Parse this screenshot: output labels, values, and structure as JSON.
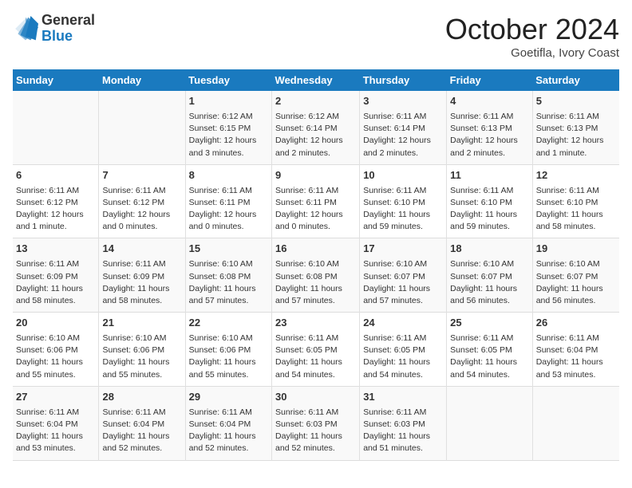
{
  "header": {
    "logo_general": "General",
    "logo_blue": "Blue",
    "month_title": "October 2024",
    "location": "Goetifla, Ivory Coast"
  },
  "days_of_week": [
    "Sunday",
    "Monday",
    "Tuesday",
    "Wednesday",
    "Thursday",
    "Friday",
    "Saturday"
  ],
  "weeks": [
    [
      {
        "day": "",
        "info": ""
      },
      {
        "day": "",
        "info": ""
      },
      {
        "day": "1",
        "info": "Sunrise: 6:12 AM\nSunset: 6:15 PM\nDaylight: 12 hours and 3 minutes."
      },
      {
        "day": "2",
        "info": "Sunrise: 6:12 AM\nSunset: 6:14 PM\nDaylight: 12 hours and 2 minutes."
      },
      {
        "day": "3",
        "info": "Sunrise: 6:11 AM\nSunset: 6:14 PM\nDaylight: 12 hours and 2 minutes."
      },
      {
        "day": "4",
        "info": "Sunrise: 6:11 AM\nSunset: 6:13 PM\nDaylight: 12 hours and 2 minutes."
      },
      {
        "day": "5",
        "info": "Sunrise: 6:11 AM\nSunset: 6:13 PM\nDaylight: 12 hours and 1 minute."
      }
    ],
    [
      {
        "day": "6",
        "info": "Sunrise: 6:11 AM\nSunset: 6:12 PM\nDaylight: 12 hours and 1 minute."
      },
      {
        "day": "7",
        "info": "Sunrise: 6:11 AM\nSunset: 6:12 PM\nDaylight: 12 hours and 0 minutes."
      },
      {
        "day": "8",
        "info": "Sunrise: 6:11 AM\nSunset: 6:11 PM\nDaylight: 12 hours and 0 minutes."
      },
      {
        "day": "9",
        "info": "Sunrise: 6:11 AM\nSunset: 6:11 PM\nDaylight: 12 hours and 0 minutes."
      },
      {
        "day": "10",
        "info": "Sunrise: 6:11 AM\nSunset: 6:10 PM\nDaylight: 11 hours and 59 minutes."
      },
      {
        "day": "11",
        "info": "Sunrise: 6:11 AM\nSunset: 6:10 PM\nDaylight: 11 hours and 59 minutes."
      },
      {
        "day": "12",
        "info": "Sunrise: 6:11 AM\nSunset: 6:10 PM\nDaylight: 11 hours and 58 minutes."
      }
    ],
    [
      {
        "day": "13",
        "info": "Sunrise: 6:11 AM\nSunset: 6:09 PM\nDaylight: 11 hours and 58 minutes."
      },
      {
        "day": "14",
        "info": "Sunrise: 6:11 AM\nSunset: 6:09 PM\nDaylight: 11 hours and 58 minutes."
      },
      {
        "day": "15",
        "info": "Sunrise: 6:10 AM\nSunset: 6:08 PM\nDaylight: 11 hours and 57 minutes."
      },
      {
        "day": "16",
        "info": "Sunrise: 6:10 AM\nSunset: 6:08 PM\nDaylight: 11 hours and 57 minutes."
      },
      {
        "day": "17",
        "info": "Sunrise: 6:10 AM\nSunset: 6:07 PM\nDaylight: 11 hours and 57 minutes."
      },
      {
        "day": "18",
        "info": "Sunrise: 6:10 AM\nSunset: 6:07 PM\nDaylight: 11 hours and 56 minutes."
      },
      {
        "day": "19",
        "info": "Sunrise: 6:10 AM\nSunset: 6:07 PM\nDaylight: 11 hours and 56 minutes."
      }
    ],
    [
      {
        "day": "20",
        "info": "Sunrise: 6:10 AM\nSunset: 6:06 PM\nDaylight: 11 hours and 55 minutes."
      },
      {
        "day": "21",
        "info": "Sunrise: 6:10 AM\nSunset: 6:06 PM\nDaylight: 11 hours and 55 minutes."
      },
      {
        "day": "22",
        "info": "Sunrise: 6:10 AM\nSunset: 6:06 PM\nDaylight: 11 hours and 55 minutes."
      },
      {
        "day": "23",
        "info": "Sunrise: 6:11 AM\nSunset: 6:05 PM\nDaylight: 11 hours and 54 minutes."
      },
      {
        "day": "24",
        "info": "Sunrise: 6:11 AM\nSunset: 6:05 PM\nDaylight: 11 hours and 54 minutes."
      },
      {
        "day": "25",
        "info": "Sunrise: 6:11 AM\nSunset: 6:05 PM\nDaylight: 11 hours and 54 minutes."
      },
      {
        "day": "26",
        "info": "Sunrise: 6:11 AM\nSunset: 6:04 PM\nDaylight: 11 hours and 53 minutes."
      }
    ],
    [
      {
        "day": "27",
        "info": "Sunrise: 6:11 AM\nSunset: 6:04 PM\nDaylight: 11 hours and 53 minutes."
      },
      {
        "day": "28",
        "info": "Sunrise: 6:11 AM\nSunset: 6:04 PM\nDaylight: 11 hours and 52 minutes."
      },
      {
        "day": "29",
        "info": "Sunrise: 6:11 AM\nSunset: 6:04 PM\nDaylight: 11 hours and 52 minutes."
      },
      {
        "day": "30",
        "info": "Sunrise: 6:11 AM\nSunset: 6:03 PM\nDaylight: 11 hours and 52 minutes."
      },
      {
        "day": "31",
        "info": "Sunrise: 6:11 AM\nSunset: 6:03 PM\nDaylight: 11 hours and 51 minutes."
      },
      {
        "day": "",
        "info": ""
      },
      {
        "day": "",
        "info": ""
      }
    ]
  ]
}
